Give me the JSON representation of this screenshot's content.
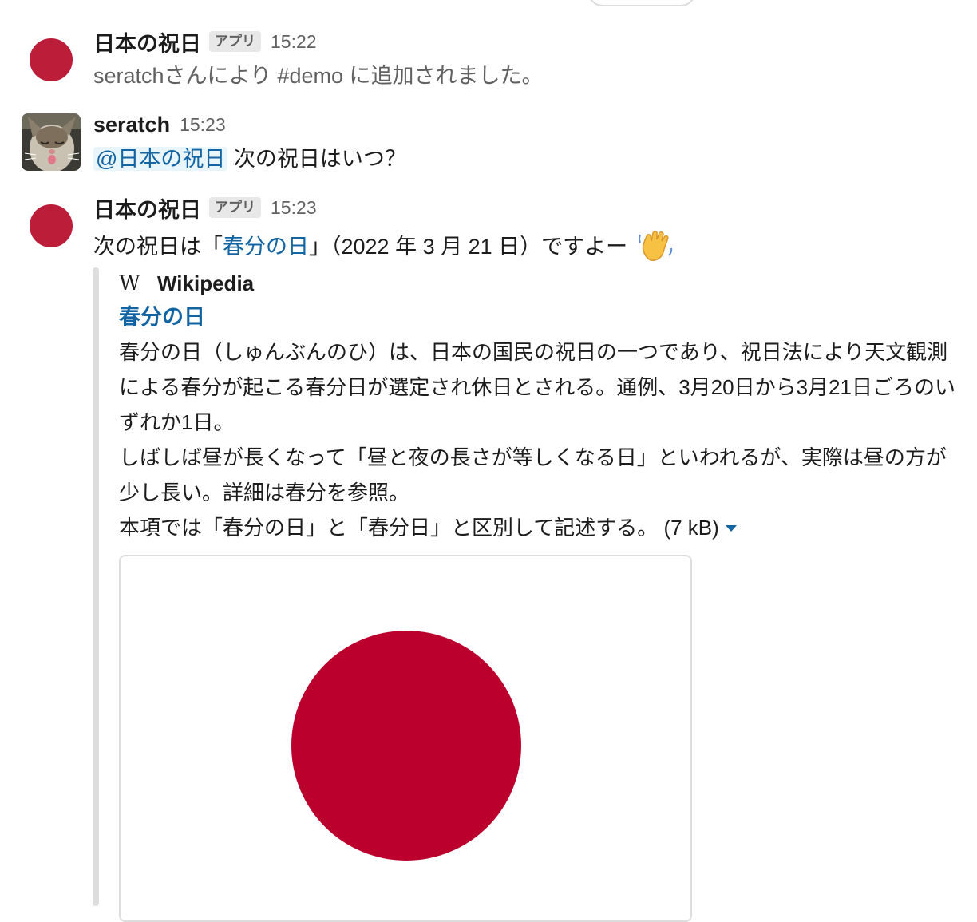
{
  "colors": {
    "flag_red": "#bc002d",
    "avatar_red": "#bc1e3a",
    "link_blue": "#1264a3",
    "mention_bg": "#e8f5fa",
    "attachment_bar": "#dddddd"
  },
  "messages": [
    {
      "avatar": "red-circle",
      "name": "日本の祝日",
      "badge": "アプリ",
      "time": "15:22",
      "text": "seratchさんにより #demo に追加されました。"
    },
    {
      "avatar": "cat-photo",
      "name": "seratch",
      "time": "15:23",
      "mention": "@日本の祝日",
      "text": "次の祝日はいつ？"
    },
    {
      "avatar": "red-circle",
      "name": "日本の祝日",
      "badge": "アプリ",
      "time": "15:23",
      "text_prefix": "次の祝日は「",
      "link_text": "春分の日",
      "text_suffix": "」（2022 年 3 月 21 日）ですよー",
      "emoji": "waving-hand-icon"
    }
  ],
  "attachment": {
    "service_icon": "W",
    "service_name": "Wikipedia",
    "title": "春分の日",
    "lines": [
      "春分の日（しゅんぶんのひ）は、日本の国民の祝日の一つであり、祝日法により天文観測",
      "による春分が起こる春分日が選定され休日とされる。通例、3月20日から3月21日ごろのい",
      "ずれか1日。",
      "しばしば昼が長くなって「昼と夜の長さが等しくなる日」といわれるが、実際は昼の方が",
      "少し長い。詳細は春分を参照。",
      "本項では「春分の日」と「春分日」と区別して記述する。"
    ],
    "size_label": "(7 kB)"
  }
}
